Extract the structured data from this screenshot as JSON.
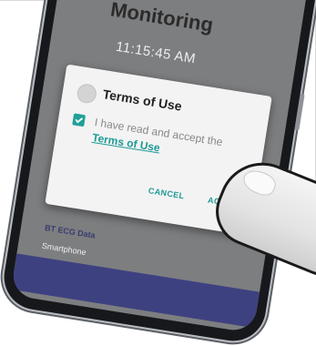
{
  "app": {
    "title": "Monitoring",
    "time": "11:15:45 AM"
  },
  "dialog": {
    "title": "Terms of Use",
    "checkbox_checked": true,
    "checkbox_text": "I have read and accept the",
    "link_text": "Terms of Use",
    "cancel_label": "CANCEL",
    "accept_label": "ACCEPT"
  },
  "section": {
    "title": "BT ECG Data",
    "subtitle": "Smartphone"
  },
  "colors": {
    "accent": "#1d9a94",
    "screen_bg": "#7d7e80",
    "bar": "#3e4180"
  }
}
